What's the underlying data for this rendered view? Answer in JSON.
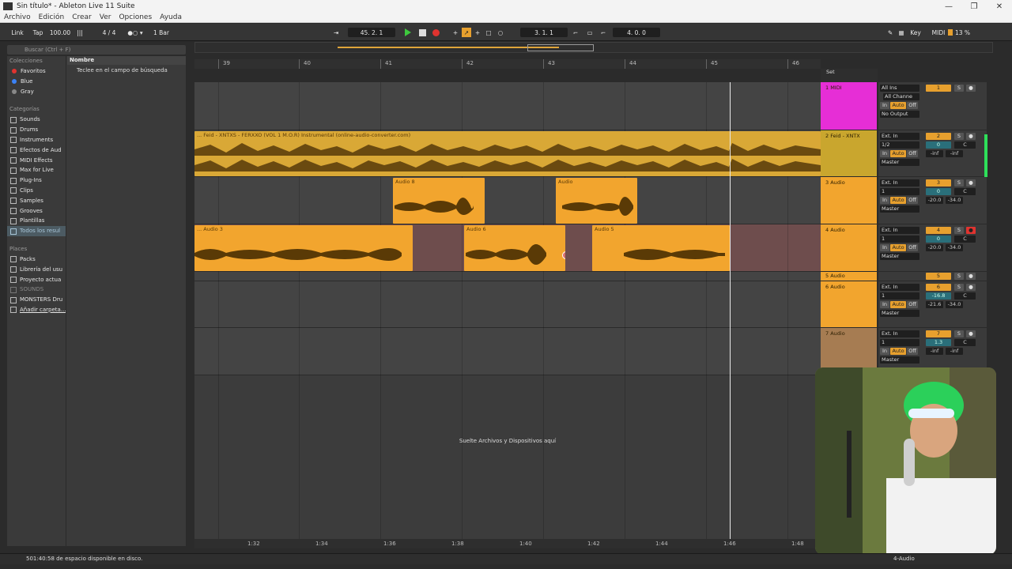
{
  "window": {
    "title": "Sin título* - Ableton Live 11 Suite",
    "controls": [
      "—",
      "❐",
      "✕"
    ]
  },
  "menu": [
    "Archivo",
    "Edición",
    "Crear",
    "Ver",
    "Opciones",
    "Ayuda"
  ],
  "transport": {
    "link": "Link",
    "tap": "Tap",
    "tempo": "100.00",
    "signature": "4 / 4",
    "quantize": "1 Bar",
    "position": "45.  2.  1",
    "loop_start": "3.  1.  1",
    "loop_length": "4.  0.  0",
    "key": "Key",
    "midi": "MIDI",
    "cpu": "13 %",
    "colors": {
      "play": "#3ec93e",
      "record": "#e0332f",
      "accent": "#e7a02e"
    }
  },
  "browser": {
    "search_placeholder": "Buscar (Ctrl + F)",
    "collections_header": "Colecciones",
    "collections": [
      {
        "label": "Favoritos",
        "color": "#e0332f"
      },
      {
        "label": "Blue",
        "color": "#3b82f6"
      },
      {
        "label": "Gray",
        "color": "#888888"
      }
    ],
    "categories_header": "Categorías",
    "categories": [
      "Sounds",
      "Drums",
      "Instruments",
      "Efectos de Aud",
      "MIDI Effects",
      "Max for Live",
      "Plug-Ins",
      "Clips",
      "Samples",
      "Grooves",
      "Plantillas",
      "Todos los resul"
    ],
    "places_header": "Places",
    "places": [
      "Packs",
      "Librería del usu",
      "Proyecto actua",
      "SOUNDS",
      "MONSTERS Dru",
      "Añadir carpeta..."
    ],
    "results_header": "Nombre",
    "results_hint": "Teclee en el campo de búsqueda"
  },
  "ruler": {
    "bars": [
      "39",
      "40",
      "41",
      "42",
      "43",
      "44",
      "45",
      "46"
    ]
  },
  "clips": {
    "track2": "... Feid - XNTXS - FERXXO (VOL 1   M.O.R)   Instrumental   (online-audio-converter.com)",
    "track3": [
      "Audio 8",
      "Audio"
    ],
    "track4": [
      "... Audio 3",
      "Audio 6",
      "Audio 5"
    ]
  },
  "arrangement_hint": "Suelte Archivos y Dispositivos aquí",
  "set_label": "Set",
  "tracks": [
    {
      "name": "1 MIDI",
      "color": "#e62ed6",
      "num": "1",
      "input": "All Ins",
      "channel": "All Channe",
      "output": "No Output",
      "vol": "",
      "pan": ""
    },
    {
      "name": "2 Feid - XNTX",
      "color": "#c9a62e",
      "num": "2",
      "input": "Ext. In",
      "channel": "1/2",
      "output": "Master",
      "vol": "0",
      "pan": "C",
      "db1": "-inf",
      "db2": "-inf"
    },
    {
      "name": "3 Audio",
      "color": "#f2a52e",
      "num": "3",
      "input": "Ext. In",
      "channel": "1",
      "output": "Master",
      "vol": "0",
      "pan": "C",
      "db1": "-20.0",
      "db2": "-34.0"
    },
    {
      "name": "4 Audio",
      "color": "#f2a52e",
      "num": "4",
      "input": "Ext. In",
      "channel": "1",
      "output": "Master",
      "vol": "0",
      "pan": "C",
      "db1": "-20.0",
      "db2": "-34.0"
    },
    {
      "name": "5 Audio",
      "color": "#f2a52e",
      "num": "5"
    },
    {
      "name": "6 Audio",
      "color": "#f2a52e",
      "num": "6",
      "input": "Ext. In",
      "channel": "1",
      "output": "Master",
      "vol": "-16.8",
      "pan": "C",
      "db1": "-21.6",
      "db2": "-34.0"
    },
    {
      "name": "7 Audio",
      "color": "#a67c52",
      "num": "7",
      "input": "Ext. In",
      "channel": "1",
      "output": "Master",
      "vol": "1.3",
      "pan": "C",
      "db1": "-inf",
      "db2": "-inf"
    }
  ],
  "io_labels": {
    "in": "In",
    "auto": "Auto",
    "off": "Off",
    "solo": "S"
  },
  "time_ruler": [
    "1:32",
    "1:34",
    "1:36",
    "1:38",
    "1:40",
    "1:42",
    "1:44",
    "1:46",
    "1:48"
  ],
  "status": {
    "message": "501:40:58 de espacio disponible en disco.",
    "selected_track": "4-Audio"
  }
}
